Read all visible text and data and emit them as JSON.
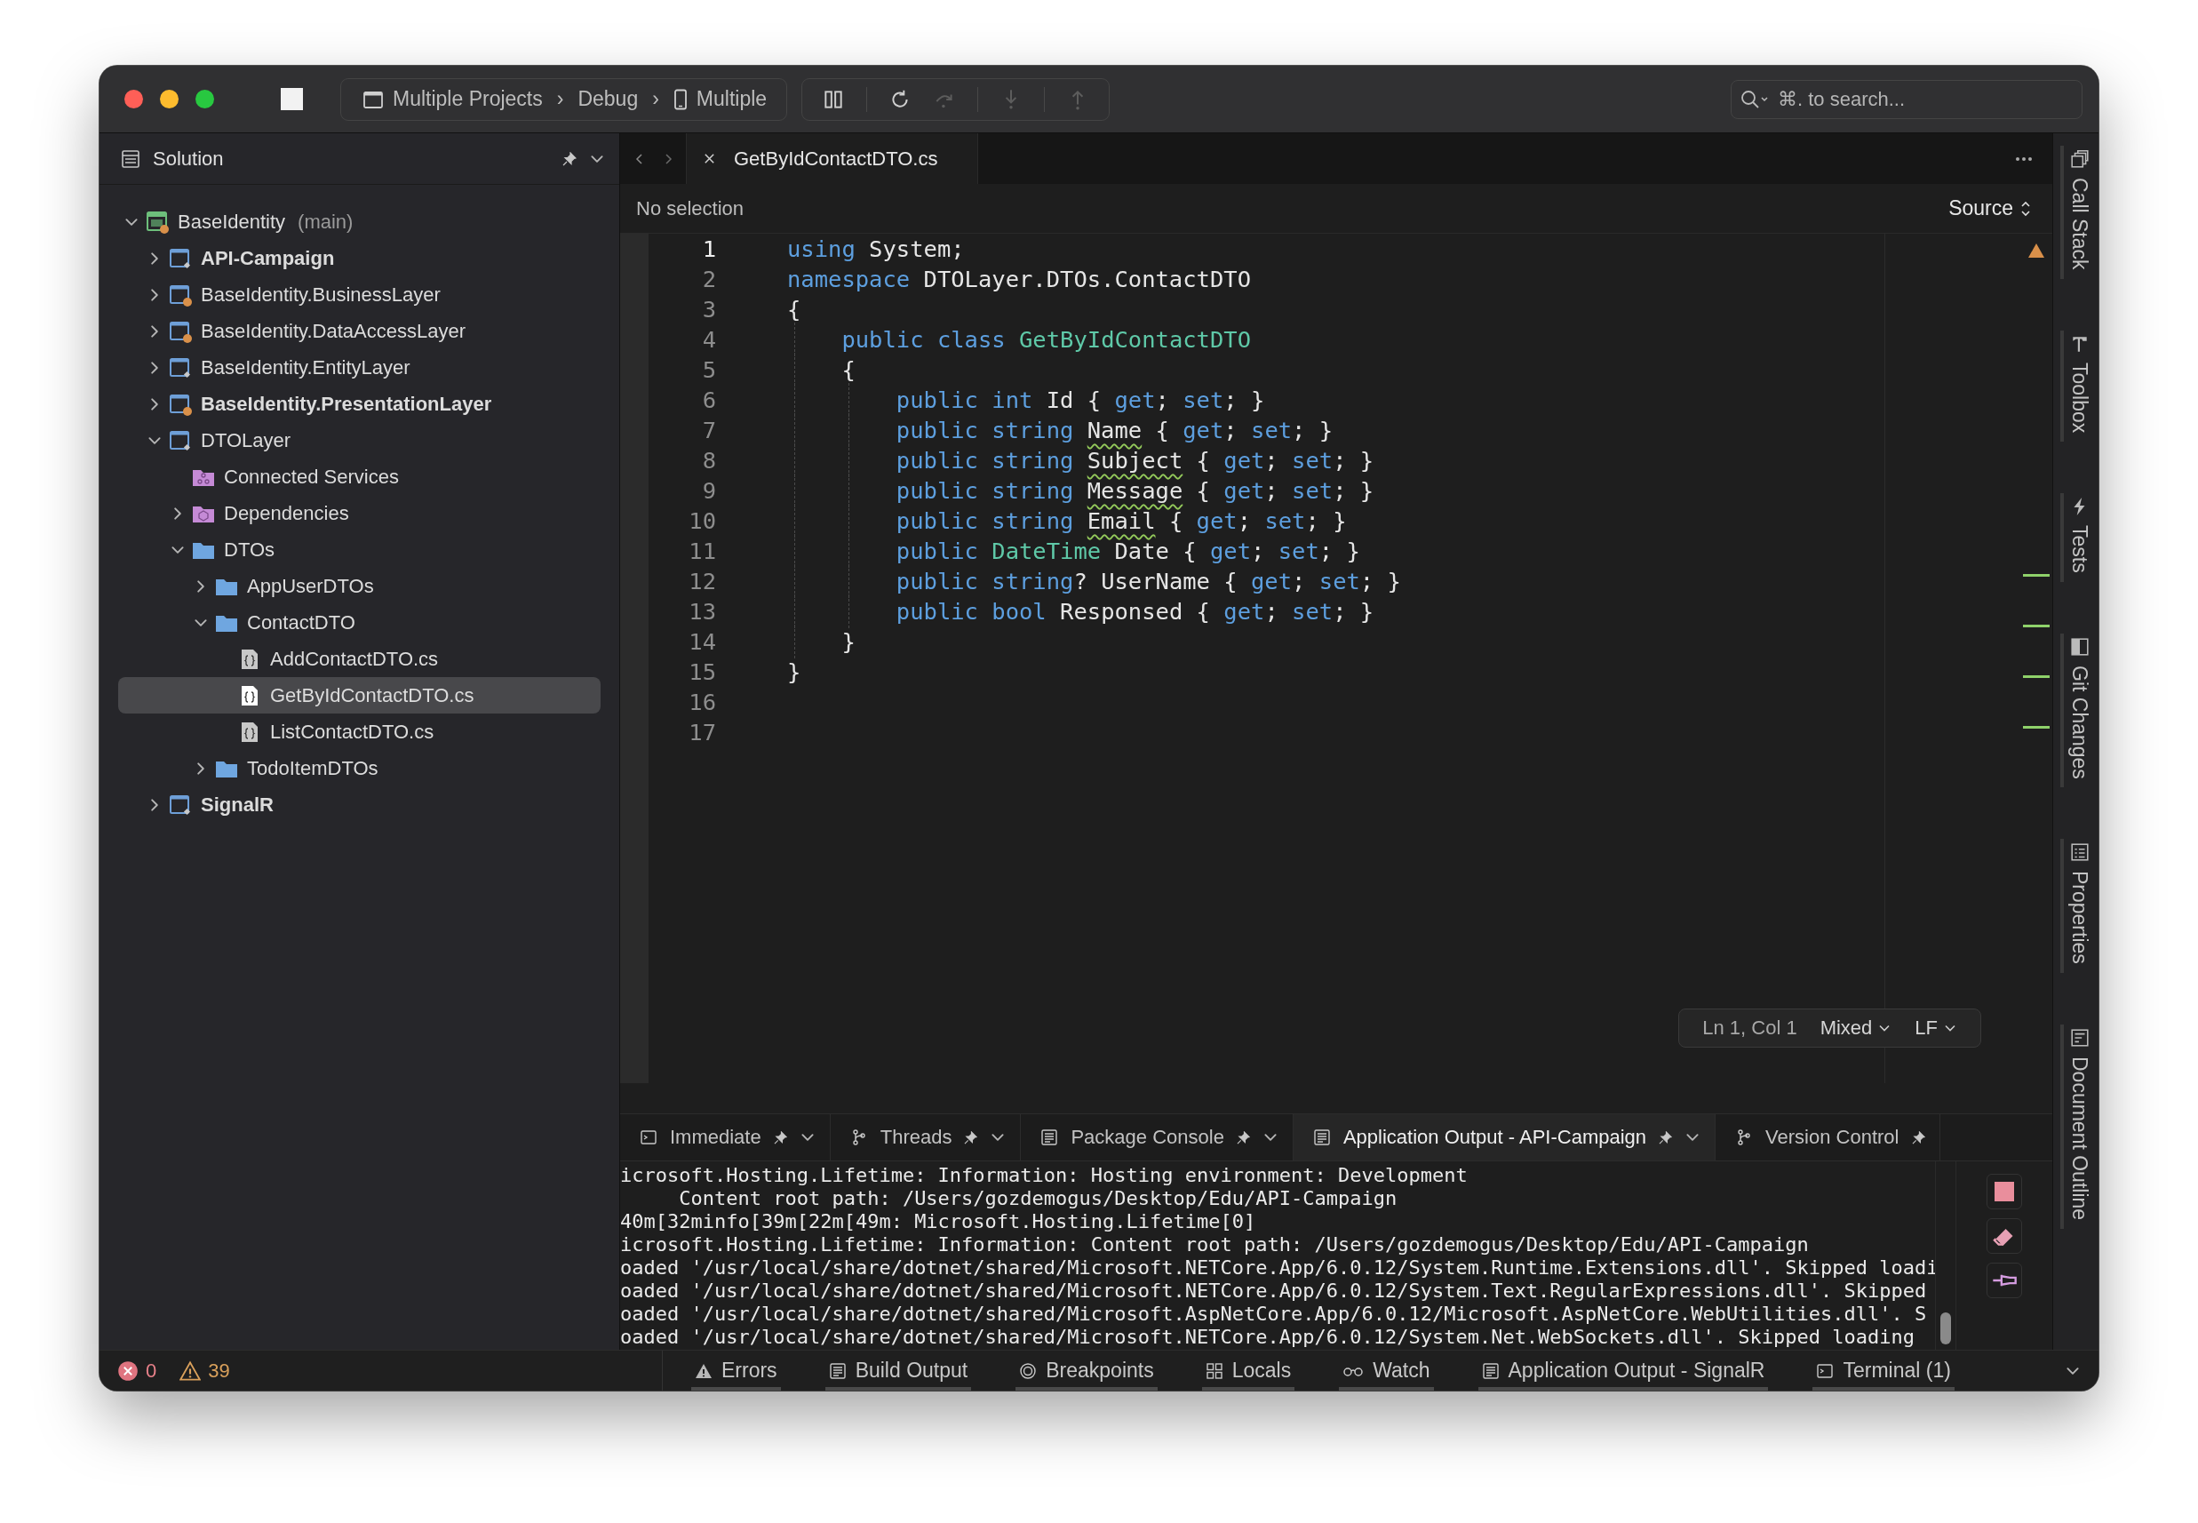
{
  "title_bar": {
    "breadcrumb": [
      {
        "kind": "project",
        "text": "Multiple Projects"
      },
      {
        "kind": "separator",
        "text": "›"
      },
      {
        "kind": "plain",
        "text": "Debug"
      },
      {
        "kind": "separator",
        "text": "›"
      },
      {
        "kind": "device",
        "text": "Multiple"
      }
    ],
    "debug_buttons": [
      {
        "kind": "pause",
        "disabled": false
      },
      {
        "kind": "restart",
        "disabled": false
      },
      {
        "kind": "step-over",
        "disabled": true
      },
      {
        "kind": "step-into",
        "disabled": true
      },
      {
        "kind": "step-out",
        "disabled": true
      }
    ],
    "search": {
      "placeholder": "⌘. to search..."
    }
  },
  "sidebar": {
    "title": "Solution",
    "tree": [
      {
        "label": "BaseIdentity",
        "note": "(main)",
        "kind": "solution",
        "bold": false,
        "selected": false,
        "expanded": true,
        "children": [
          {
            "label": "API-Campaign",
            "kind": "project",
            "bold": true,
            "selected": false,
            "expanded": false
          },
          {
            "label": "BaseIdentity.BusinessLayer",
            "kind": "project-alert",
            "bold": false,
            "selected": false,
            "expanded": false
          },
          {
            "label": "BaseIdentity.DataAccessLayer",
            "kind": "project-alert",
            "bold": false,
            "selected": false,
            "expanded": false
          },
          {
            "label": "BaseIdentity.EntityLayer",
            "kind": "project",
            "bold": false,
            "selected": false,
            "expanded": false
          },
          {
            "label": "BaseIdentity.PresentationLayer",
            "kind": "project-alert",
            "bold": true,
            "selected": false,
            "expanded": false
          },
          {
            "label": "DTOLayer",
            "kind": "project",
            "bold": false,
            "selected": false,
            "expanded": true,
            "children": [
              {
                "label": "Connected Services",
                "kind": "service",
                "bold": false,
                "selected": false
              },
              {
                "label": "Dependencies",
                "kind": "dependency",
                "bold": false,
                "selected": false,
                "expanded": false
              },
              {
                "label": "DTOs",
                "kind": "folder",
                "bold": false,
                "selected": false,
                "expanded": true,
                "children": [
                  {
                    "label": "AppUserDTOs",
                    "kind": "folder",
                    "bold": false,
                    "selected": false,
                    "expanded": false
                  },
                  {
                    "label": "ContactDTO",
                    "kind": "folder",
                    "bold": false,
                    "selected": false,
                    "expanded": true,
                    "children": [
                      {
                        "label": "AddContactDTO.cs",
                        "kind": "file",
                        "bold": false,
                        "selected": false
                      },
                      {
                        "label": "GetByIdContactDTO.cs",
                        "kind": "file",
                        "bold": false,
                        "selected": true
                      },
                      {
                        "label": "ListContactDTO.cs",
                        "kind": "file",
                        "bold": false,
                        "selected": false
                      }
                    ]
                  },
                  {
                    "label": "TodoItemDTOs",
                    "kind": "folder",
                    "bold": false,
                    "selected": false,
                    "expanded": false
                  }
                ]
              }
            ]
          },
          {
            "label": "SignalR",
            "kind": "project",
            "bold": true,
            "selected": false,
            "expanded": false
          }
        ]
      }
    ]
  },
  "editor": {
    "tab": {
      "label": "GetByIdContactDTO.cs"
    },
    "selection_label": "No selection",
    "view_mode": "Source",
    "lines": [
      {
        "number": "1",
        "current": true,
        "tokens": [
          {
            "kind": "keyword",
            "text": "using"
          },
          {
            "kind": "plain",
            "text": " System;"
          }
        ]
      },
      {
        "number": "2",
        "current": false,
        "tokens": [
          {
            "kind": "keyword",
            "text": "namespace"
          },
          {
            "kind": "plain",
            "text": " DTOLayer.DTOs.ContactDTO"
          }
        ]
      },
      {
        "number": "3",
        "current": false,
        "tokens": [
          {
            "kind": "plain",
            "text": "{"
          }
        ]
      },
      {
        "number": "4",
        "current": false,
        "tokens": [
          {
            "kind": "keyword",
            "text": "    public "
          },
          {
            "kind": "keyword",
            "text": "class "
          },
          {
            "kind": "type",
            "text": "GetByIdContactDTO"
          }
        ]
      },
      {
        "number": "5",
        "current": false,
        "tokens": [
          {
            "kind": "plain",
            "text": "    {"
          }
        ]
      },
      {
        "number": "6",
        "current": false,
        "tokens": [
          {
            "kind": "keyword",
            "text": "        public "
          },
          {
            "kind": "keyword",
            "text": "int"
          },
          {
            "kind": "plain",
            "text": " Id { "
          },
          {
            "kind": "keyword",
            "text": "get"
          },
          {
            "kind": "plain",
            "text": "; "
          },
          {
            "kind": "keyword",
            "text": "set"
          },
          {
            "kind": "plain",
            "text": "; }"
          }
        ]
      },
      {
        "number": "7",
        "current": false,
        "tokens": [
          {
            "kind": "keyword",
            "text": "        public "
          },
          {
            "kind": "keyword",
            "text": "string "
          },
          {
            "kind": "plain",
            "text": "Name",
            "squiggle": true
          },
          {
            "kind": "plain",
            "text": " { "
          },
          {
            "kind": "keyword",
            "text": "get"
          },
          {
            "kind": "plain",
            "text": "; "
          },
          {
            "kind": "keyword",
            "text": "set"
          },
          {
            "kind": "plain",
            "text": "; }"
          }
        ]
      },
      {
        "number": "8",
        "current": false,
        "tokens": [
          {
            "kind": "keyword",
            "text": "        public "
          },
          {
            "kind": "keyword",
            "text": "string "
          },
          {
            "kind": "plain",
            "text": "Subject",
            "squiggle": true
          },
          {
            "kind": "plain",
            "text": " { "
          },
          {
            "kind": "keyword",
            "text": "get"
          },
          {
            "kind": "plain",
            "text": "; "
          },
          {
            "kind": "keyword",
            "text": "set"
          },
          {
            "kind": "plain",
            "text": "; }"
          }
        ]
      },
      {
        "number": "9",
        "current": false,
        "tokens": [
          {
            "kind": "keyword",
            "text": "        public "
          },
          {
            "kind": "keyword",
            "text": "string "
          },
          {
            "kind": "plain",
            "text": "Message",
            "squiggle": true
          },
          {
            "kind": "plain",
            "text": " { "
          },
          {
            "kind": "keyword",
            "text": "get"
          },
          {
            "kind": "plain",
            "text": "; "
          },
          {
            "kind": "keyword",
            "text": "set"
          },
          {
            "kind": "plain",
            "text": "; }"
          }
        ]
      },
      {
        "number": "10",
        "current": false,
        "tokens": [
          {
            "kind": "keyword",
            "text": "        public "
          },
          {
            "kind": "keyword",
            "text": "string "
          },
          {
            "kind": "plain",
            "text": "Email",
            "squiggle": true
          },
          {
            "kind": "plain",
            "text": " { "
          },
          {
            "kind": "keyword",
            "text": "get"
          },
          {
            "kind": "plain",
            "text": "; "
          },
          {
            "kind": "keyword",
            "text": "set"
          },
          {
            "kind": "plain",
            "text": "; }"
          }
        ]
      },
      {
        "number": "11",
        "current": false,
        "tokens": [
          {
            "kind": "keyword",
            "text": "        public "
          },
          {
            "kind": "type",
            "text": "DateTime"
          },
          {
            "kind": "plain",
            "text": " Date { "
          },
          {
            "kind": "keyword",
            "text": "get"
          },
          {
            "kind": "plain",
            "text": "; "
          },
          {
            "kind": "keyword",
            "text": "set"
          },
          {
            "kind": "plain",
            "text": "; }"
          }
        ]
      },
      {
        "number": "12",
        "current": false,
        "tokens": [
          {
            "kind": "keyword",
            "text": "        public "
          },
          {
            "kind": "keyword",
            "text": "string"
          },
          {
            "kind": "plain",
            "text": "? UserName { "
          },
          {
            "kind": "keyword",
            "text": "get"
          },
          {
            "kind": "plain",
            "text": "; "
          },
          {
            "kind": "keyword",
            "text": "set"
          },
          {
            "kind": "plain",
            "text": "; }"
          }
        ]
      },
      {
        "number": "13",
        "current": false,
        "tokens": [
          {
            "kind": "keyword",
            "text": "        public "
          },
          {
            "kind": "keyword",
            "text": "bool"
          },
          {
            "kind": "plain",
            "text": " Responsed { "
          },
          {
            "kind": "keyword",
            "text": "get"
          },
          {
            "kind": "plain",
            "text": "; "
          },
          {
            "kind": "keyword",
            "text": "set"
          },
          {
            "kind": "plain",
            "text": "; }"
          }
        ]
      },
      {
        "number": "14",
        "current": false,
        "tokens": [
          {
            "kind": "plain",
            "text": "    }"
          }
        ]
      },
      {
        "number": "15",
        "current": false,
        "tokens": [
          {
            "kind": "plain",
            "text": "}"
          }
        ]
      },
      {
        "number": "16",
        "current": false
      },
      {
        "number": "17",
        "current": false
      }
    ],
    "status": {
      "position": "Ln 1, Col 1",
      "indentation": "Mixed",
      "line_ending": "LF"
    }
  },
  "pad": {
    "tabs": [
      {
        "kind": "immediate",
        "label": "Immediate",
        "selected": false
      },
      {
        "kind": "threads",
        "label": "Threads",
        "selected": false
      },
      {
        "kind": "package",
        "label": "Package Console",
        "selected": false
      },
      {
        "kind": "output",
        "label": "Application Output - API-Campaign",
        "selected": true
      },
      {
        "kind": "version-control",
        "label": "Version Control",
        "selected": false
      }
    ],
    "output": [
      "icrosoft.Hosting.Lifetime: Information: Hosting environment: Development",
      "     Content root path: /Users/gozdemogus/Desktop/Edu/API-Campaign",
      "40m[32minfo[39m[22m[49m: Microsoft.Hosting.Lifetime[0]",
      "icrosoft.Hosting.Lifetime: Information: Content root path: /Users/gozdemogus/Desktop/Edu/API-Campaign",
      "oaded '/usr/local/share/dotnet/shared/Microsoft.NETCore.App/6.0.12/System.Runtime.Extensions.dll'. Skipped loadi",
      "oaded '/usr/local/share/dotnet/shared/Microsoft.NETCore.App/6.0.12/System.Text.RegularExpressions.dll'. Skipped",
      "oaded '/usr/local/share/dotnet/shared/Microsoft.AspNetCore.App/6.0.12/Microsoft.AspNetCore.WebUtilities.dll'. S",
      "oaded '/usr/local/share/dotnet/shared/Microsoft.NETCore.App/6.0.12/System.Net.WebSockets.dll'. Skipped loading"
    ]
  },
  "status_bar": {
    "errors": "0",
    "warnings": "39",
    "pads": [
      {
        "kind": "errors",
        "label": "Errors"
      },
      {
        "kind": "build",
        "label": "Build Output"
      },
      {
        "kind": "breakpoints",
        "label": "Breakpoints"
      },
      {
        "kind": "locals",
        "label": "Locals"
      },
      {
        "kind": "watch",
        "label": "Watch"
      },
      {
        "kind": "output",
        "label": "Application Output - SignalR"
      },
      {
        "kind": "terminal",
        "label": "Terminal (1)"
      }
    ]
  },
  "side_pads": [
    {
      "kind": "call-stack",
      "label": "Call Stack"
    },
    {
      "kind": "toolbox",
      "label": "Toolbox"
    },
    {
      "kind": "tests",
      "label": "Tests"
    },
    {
      "kind": "git",
      "label": "Git Changes"
    },
    {
      "kind": "properties",
      "label": "Properties"
    },
    {
      "kind": "outline",
      "label": "Document Outline"
    }
  ]
}
